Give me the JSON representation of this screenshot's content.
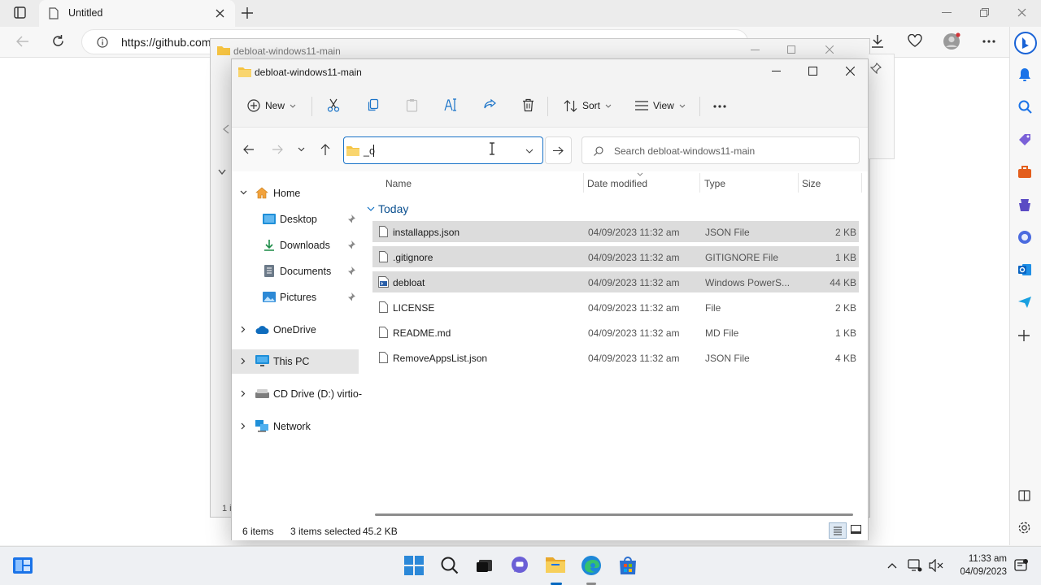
{
  "browser": {
    "tab_title": "Untitled",
    "url": "https://github.com"
  },
  "back_window": {
    "title": "debloat-windows11-main",
    "left_count": "1 i"
  },
  "explorer": {
    "title": "debloat-windows11-main",
    "commands": {
      "new_label": "New",
      "sort_label": "Sort",
      "view_label": "View"
    },
    "address_value": "_o",
    "search_placeholder": "Search debloat-windows11-main",
    "columns": {
      "name": "Name",
      "date_modified": "Date modified",
      "type": "Type",
      "size": "Size"
    },
    "group_label": "Today",
    "nav": {
      "home": "Home",
      "desktop": "Desktop",
      "downloads": "Downloads",
      "documents": "Documents",
      "pictures": "Pictures",
      "onedrive": "OneDrive",
      "this_pc": "This PC",
      "cd_drive": "CD Drive (D:) virtio-",
      "network": "Network"
    },
    "files": [
      {
        "name": "installapps.json",
        "date": "04/09/2023 11:32 am",
        "type": "JSON File",
        "size": "2 KB",
        "selected": true
      },
      {
        "name": ".gitignore",
        "date": "04/09/2023 11:32 am",
        "type": "GITIGNORE File",
        "size": "1 KB",
        "selected": true
      },
      {
        "name": "debloat",
        "date": "04/09/2023 11:32 am",
        "type": "Windows PowerS...",
        "size": "44 KB",
        "selected": true
      },
      {
        "name": "LICENSE",
        "date": "04/09/2023 11:32 am",
        "type": "File",
        "size": "2 KB",
        "selected": false
      },
      {
        "name": "README.md",
        "date": "04/09/2023 11:32 am",
        "type": "MD File",
        "size": "1 KB",
        "selected": false
      },
      {
        "name": "RemoveAppsList.json",
        "date": "04/09/2023 11:32 am",
        "type": "JSON File",
        "size": "4 KB",
        "selected": false
      }
    ],
    "status": {
      "item_count": "6 items",
      "selected": "3 items selected",
      "selected_size": "45.2 KB"
    }
  },
  "taskbar": {
    "time": "11:33 am",
    "date": "04/09/2023"
  },
  "colors": {
    "accent": "#0067c0",
    "selection": "#dcdcdc",
    "folder": "#f5c342"
  }
}
